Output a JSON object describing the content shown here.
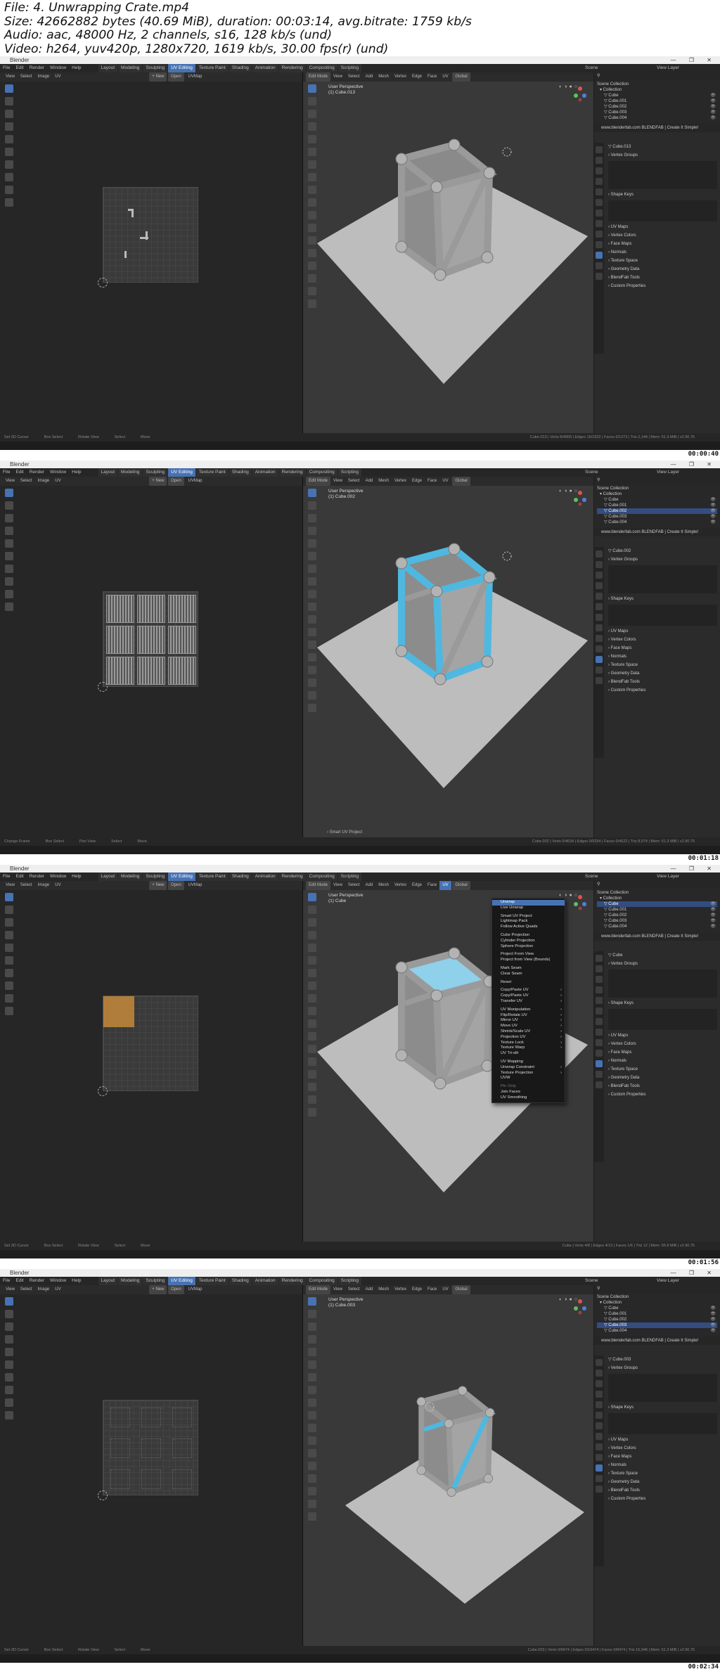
{
  "header": {
    "file": "File: 4. Unwrapping Crate.mp4",
    "size": "Size: 42662882 bytes (40.69 MiB), duration: 00:03:14, avg.bitrate: 1759 kb/s",
    "audio": "Audio: aac, 48000 Hz, 2 channels, s16, 128 kb/s (und)",
    "video": "Video: h264, yuv420p, 1280x720, 1619 kb/s, 30.00 fps(r) (und)"
  },
  "colors": {
    "accent": "#4772b3",
    "selection_blue": "#4fb8e0",
    "uv_face_orange": "#c48a3a"
  },
  "app": {
    "title": "Blender",
    "menus": [
      "File",
      "Edit",
      "Render",
      "Window",
      "Help"
    ],
    "workspaces": [
      "Layout",
      "Modeling",
      "Sculpting",
      "UV Editing",
      "Texture Paint",
      "Shading",
      "Animation",
      "Rendering",
      "Compositing",
      "Scripting"
    ],
    "active_workspace": "UV Editing",
    "scene": "Scene",
    "view_layer": "View Layer"
  },
  "uv_header": {
    "items": [
      "View",
      "Select",
      "Image",
      "UV"
    ],
    "new": "New",
    "open": "Open",
    "uvmap": "UVMap"
  },
  "vp_header": {
    "mode": "Edit Mode",
    "items": [
      "View",
      "Select",
      "Add",
      "Mesh",
      "Vertex",
      "Edge",
      "Face",
      "UV"
    ],
    "orientation": "Global"
  },
  "frames": [
    {
      "timestamp": "00:00:40",
      "vp_title": "User Perspective",
      "vp_object": "(1) Cube.013",
      "active_object": "Cube.013",
      "status_left": [
        "Set 3D Cursor",
        "Box Select",
        "Rotate View",
        "Select",
        "Move"
      ],
      "stats": "Cube.013 | Verts 8/4800 | Edges 16/2322 | Faces 0/1273 | Tris 2,144 | Mem: 51.3 MiB | v2.90.75"
    },
    {
      "timestamp": "00:01:18",
      "vp_title": "User Perspective",
      "vp_object": "(1) Cube.002",
      "active_object": "Cube.002",
      "caption": "Smart UV Project",
      "status_left": [
        "Change Frame",
        "Box Select",
        "Pan View",
        "Select",
        "Move"
      ],
      "stats": "Cube.002 | Verts 0/4634 | Edges 0/9254 | Faces 0/4622 | Tris 8,974 | Mem: 51.3 MiB | v2.90.75"
    },
    {
      "timestamp": "00:01:56",
      "vp_title": "User Perspective",
      "vp_object": "(1) Cube",
      "active_object": "Cube",
      "status_left": [
        "Set 3D Cursor",
        "Box Select",
        "Rotate View",
        "Select",
        "Move"
      ],
      "stats": "Cube | Verts 4/8 | Edges 4/12 | Faces 1/6 | Tris 12 | Mem: 55.8 MiB | v2.90.75",
      "uv_menu": {
        "items": [
          "Unwrap",
          "Live Unwrap",
          "",
          "Smart UV Project",
          "Lightmap Pack",
          "Follow Active Quads",
          "",
          "Cube Projection",
          "Cylinder Projection",
          "Sphere Projection",
          "",
          "Project From View",
          "Project from View (Bounds)",
          "",
          "Mark Seam",
          "Clear Seam",
          "",
          "Reset",
          "",
          "Copy/Paste UV",
          "Copy/Paste UV",
          "Transfer UV",
          "",
          "UV Manipulation",
          "Flip/Rotate UV",
          "Mirror UV",
          "Move UV",
          "Shrink/Scale UV",
          "Projection UV",
          "Texture Lock",
          "Texture Warp",
          "UV Tri-slit",
          "",
          "UV Mapping",
          "Unwrap Constraint",
          "Texture Projection",
          "UVW",
          "",
          "Pin Only",
          "Join Faces",
          "UV Smoothing"
        ],
        "highlight": "Unwrap"
      }
    },
    {
      "timestamp": "00:02:34",
      "vp_title": "User Perspective",
      "vp_object": "(1) Cube.003",
      "active_object": "Cube.003",
      "status_left": [
        "Set 3D Cursor",
        "Box Select",
        "Rotate View",
        "Select",
        "Move"
      ],
      "stats": "Cube.003 | Verts 0/8474 | Edges 0/16474 | Faces 0/8474 | Tris 16,948 | Mem: 51.3 MiB | v2.90.75"
    }
  ],
  "outliner": {
    "title": "Scene Collection",
    "collection": "Collection",
    "objects": [
      "Cube",
      "Cube.001",
      "Cube.002",
      "Cube.003",
      "Cube.004"
    ]
  },
  "watermark": "www.blenderfab.com    BLENDFAB | Create It Simple!",
  "properties": {
    "sections": [
      "Vertex Groups",
      "Shape Keys",
      "UV Maps",
      "Vertex Colors",
      "Face Maps",
      "Normals",
      "Texture Space",
      "Geometry Data",
      "BlendFab Tools",
      "Custom Properties"
    ]
  }
}
